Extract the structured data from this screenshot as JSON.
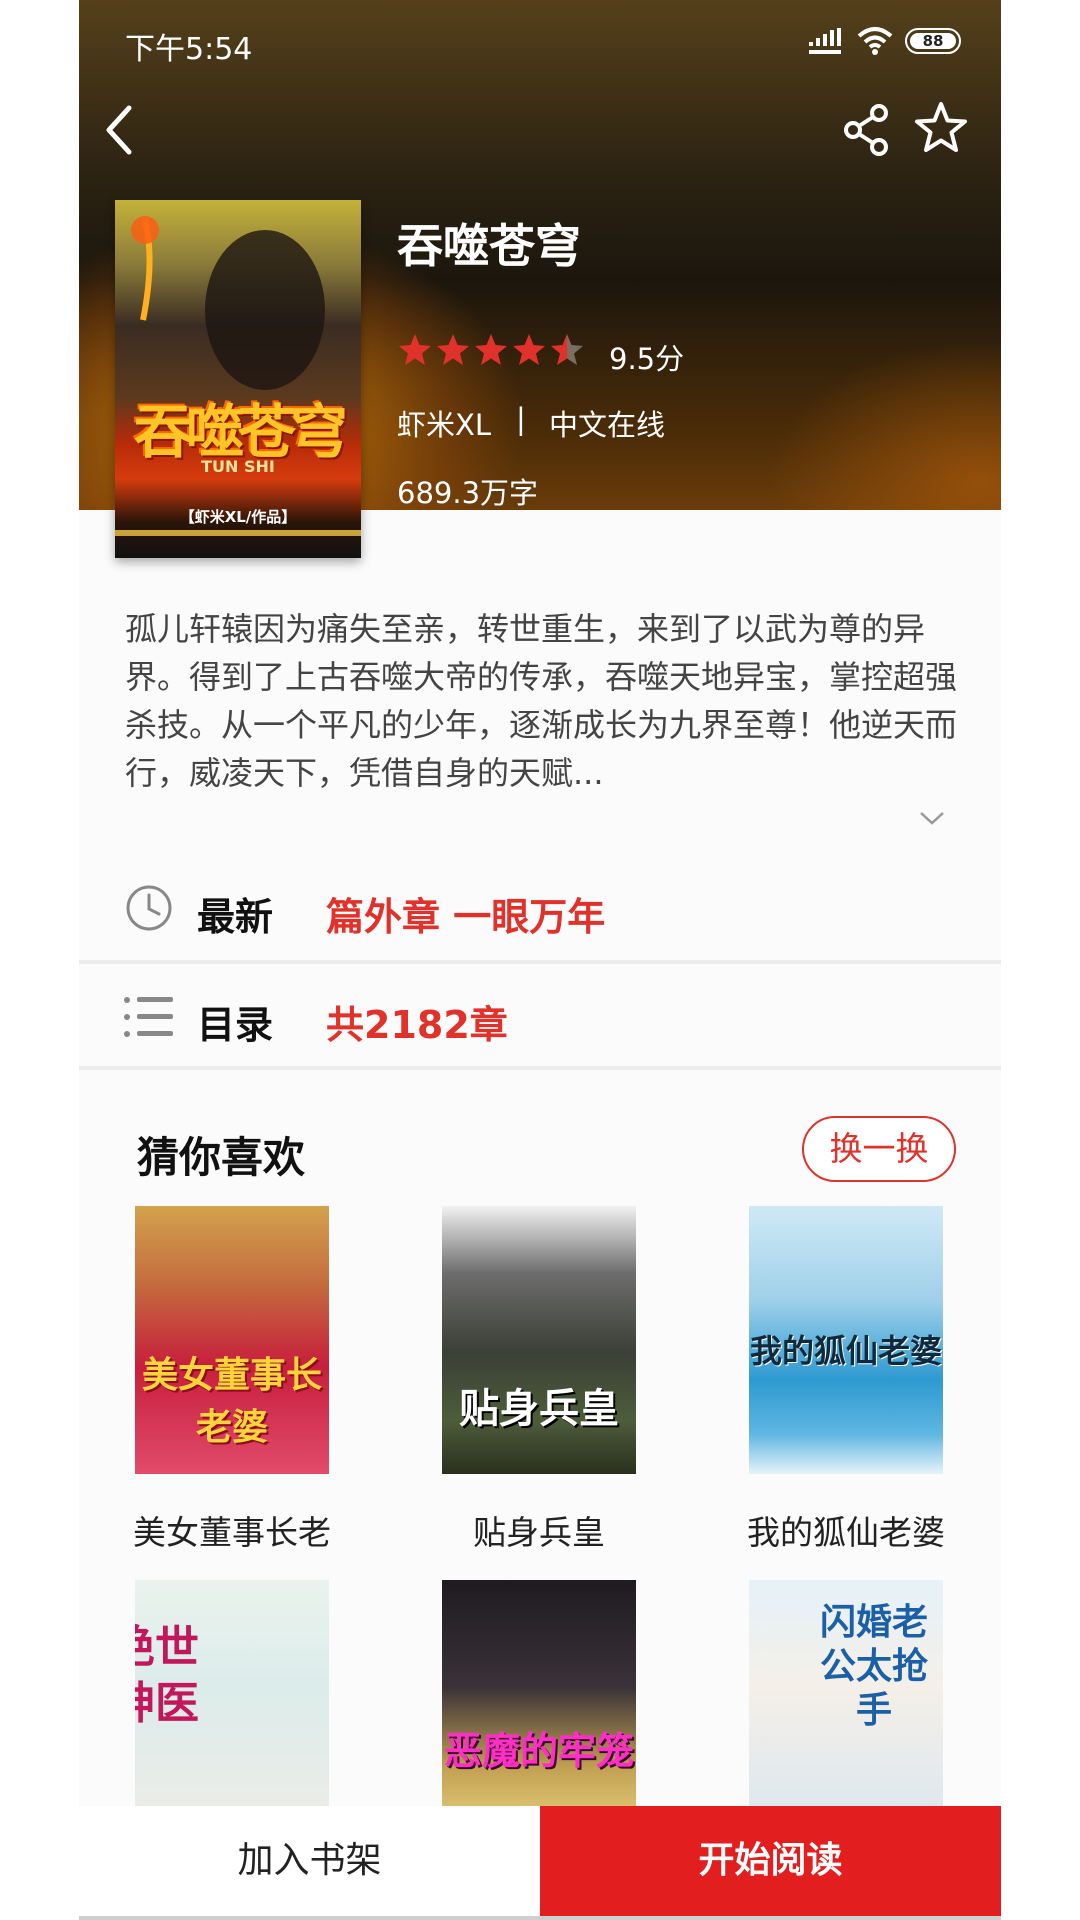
{
  "status_bar": {
    "time": "下午5:54",
    "battery": "88"
  },
  "icons": {
    "back": "back-arrow-icon",
    "share": "share-icon",
    "favorite": "star-outline-icon",
    "clock": "clock-icon",
    "list": "list-icon",
    "expand": "chevron-down-icon"
  },
  "book": {
    "title": "吞噬苍穹",
    "cover_title": "吞噬苍穹",
    "cover_pinyin": "TUN SHI",
    "cover_author": "【虾米XL/作品】",
    "rating": 4.5,
    "rating_max": 5,
    "rating_text": "9.5分",
    "author": "虾米XL",
    "separator": "|",
    "publisher": "中文在线",
    "word_count": "689.3万字",
    "synopsis": "孤儿轩辕因为痛失至亲，转世重生，来到了以武为尊的异界。得到了上古吞噬大帝的传承，吞噬天地异宝，掌控超强杀技。从一个平凡的少年，逐渐成长为九界至尊！他逆天而行，威凌天下，凭借自身的天赋..."
  },
  "latest": {
    "label": "最新",
    "value": "篇外章 一眼万年"
  },
  "toc": {
    "label": "目录",
    "value": "共2182章"
  },
  "recommend": {
    "title": "猜你喜欢",
    "refresh_label": "换一换",
    "books": [
      {
        "name": "美女董事长老",
        "cover_text": "美女董事长老婆"
      },
      {
        "name": "贴身兵皇",
        "cover_text": "贴身兵皇"
      },
      {
        "name": "我的狐仙老婆",
        "cover_text": "我的狐仙老婆"
      },
      {
        "name": "",
        "cover_text": "绝世神医"
      },
      {
        "name": "",
        "cover_text": "恶魔的牢笼"
      },
      {
        "name": "",
        "cover_text": "闪婚老公太抢手"
      }
    ]
  },
  "actions": {
    "add_shelf": "加入书架",
    "start_reading": "开始阅读"
  },
  "colors": {
    "accent": "#e0312b",
    "primary_button": "#e21e1e"
  }
}
